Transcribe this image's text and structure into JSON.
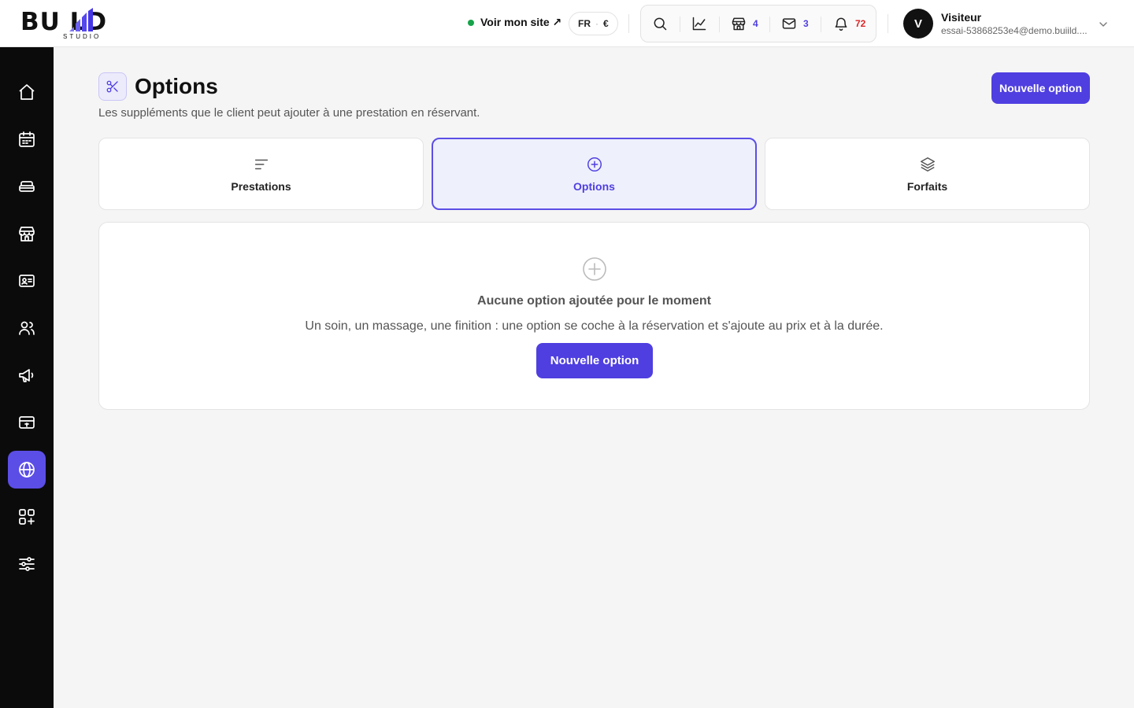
{
  "brand": {
    "word": "BU  LD",
    "sub": "STUDIO"
  },
  "header": {
    "site_link": "Voir mon site ↗",
    "lang": "FR",
    "currency": "€",
    "tools": {
      "shops_count": "4",
      "messages_count": "3",
      "notifications_count": "72"
    },
    "user": {
      "initial": "V",
      "name": "Visiteur",
      "email": "essai-53868253e4@demo.buiild...."
    }
  },
  "sidebar": {
    "items": [
      {
        "icon": "home-icon"
      },
      {
        "icon": "calendar-icon"
      },
      {
        "icon": "stack-icon"
      },
      {
        "icon": "store-icon"
      },
      {
        "icon": "contact-card-icon"
      },
      {
        "icon": "users-icon"
      },
      {
        "icon": "megaphone-icon"
      },
      {
        "icon": "wallet-icon"
      },
      {
        "icon": "globe-icon",
        "active": true
      },
      {
        "icon": "apps-add-icon"
      },
      {
        "icon": "sliders-icon"
      }
    ]
  },
  "page": {
    "title": "Options",
    "subtitle": "Les suppléments que le client peut ajouter à une prestation en réservant.",
    "new_button": "Nouvelle option"
  },
  "tabs": [
    {
      "label": "Prestations",
      "icon": "list-icon"
    },
    {
      "label": "Options",
      "icon": "plus-circle-icon",
      "active": true
    },
    {
      "label": "Forfaits",
      "icon": "layers-icon"
    }
  ],
  "empty_state": {
    "title": "Aucune option ajoutée pour le moment",
    "description": "Un soin, un massage, une finition : une option se coche à la réservation et s'ajoute au prix et à la durée.",
    "button": "Nouvelle option"
  },
  "colors": {
    "accent": "#4f3fe0",
    "status_online": "#16a34a",
    "notification": "#dc2626"
  }
}
